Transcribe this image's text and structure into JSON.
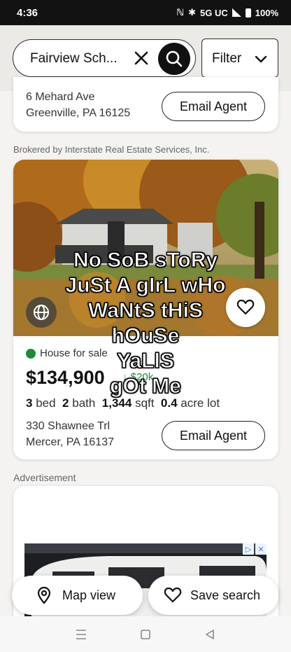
{
  "status_bar": {
    "time": "4:36",
    "network": "5G UC",
    "battery": "100%"
  },
  "search": {
    "value": "Fairview Sch..."
  },
  "filter": {
    "label": "Filter"
  },
  "listing_prev": {
    "address_line1": "6 Mehard Ave",
    "address_line2": "Greenville, PA 16125",
    "email_label": "Email Agent"
  },
  "broker_text": "Brokered by Interstate Real Estate Services, Inc.",
  "listing": {
    "status": "House for sale",
    "price": "$134,900",
    "price_drop": "↓ $20k",
    "beds_value": "3",
    "beds_label": "bed",
    "baths_value": "2",
    "baths_label": "bath",
    "sqft_value": "1,344",
    "sqft_label": "sqft",
    "lot_value": "0.4",
    "lot_label": "acre lot",
    "address_line1": "330 Shawnee Trl",
    "address_line2": "Mercer, PA 16137",
    "email_label": "Email Agent"
  },
  "overlay_caption": {
    "line1": "No SoB sToRy",
    "line2": "JuSt A gIrL wHo",
    "line3": "WaNtS tHiS",
    "line4": "hOuSe",
    "line5": "YaLlS",
    "line6": "gOt Me"
  },
  "ad_label": "Advertisement",
  "bottom": {
    "map_label": "Map view",
    "save_label": "Save search"
  },
  "colors": {
    "accent_green": "#1f8a3a",
    "dark": "#111111"
  }
}
